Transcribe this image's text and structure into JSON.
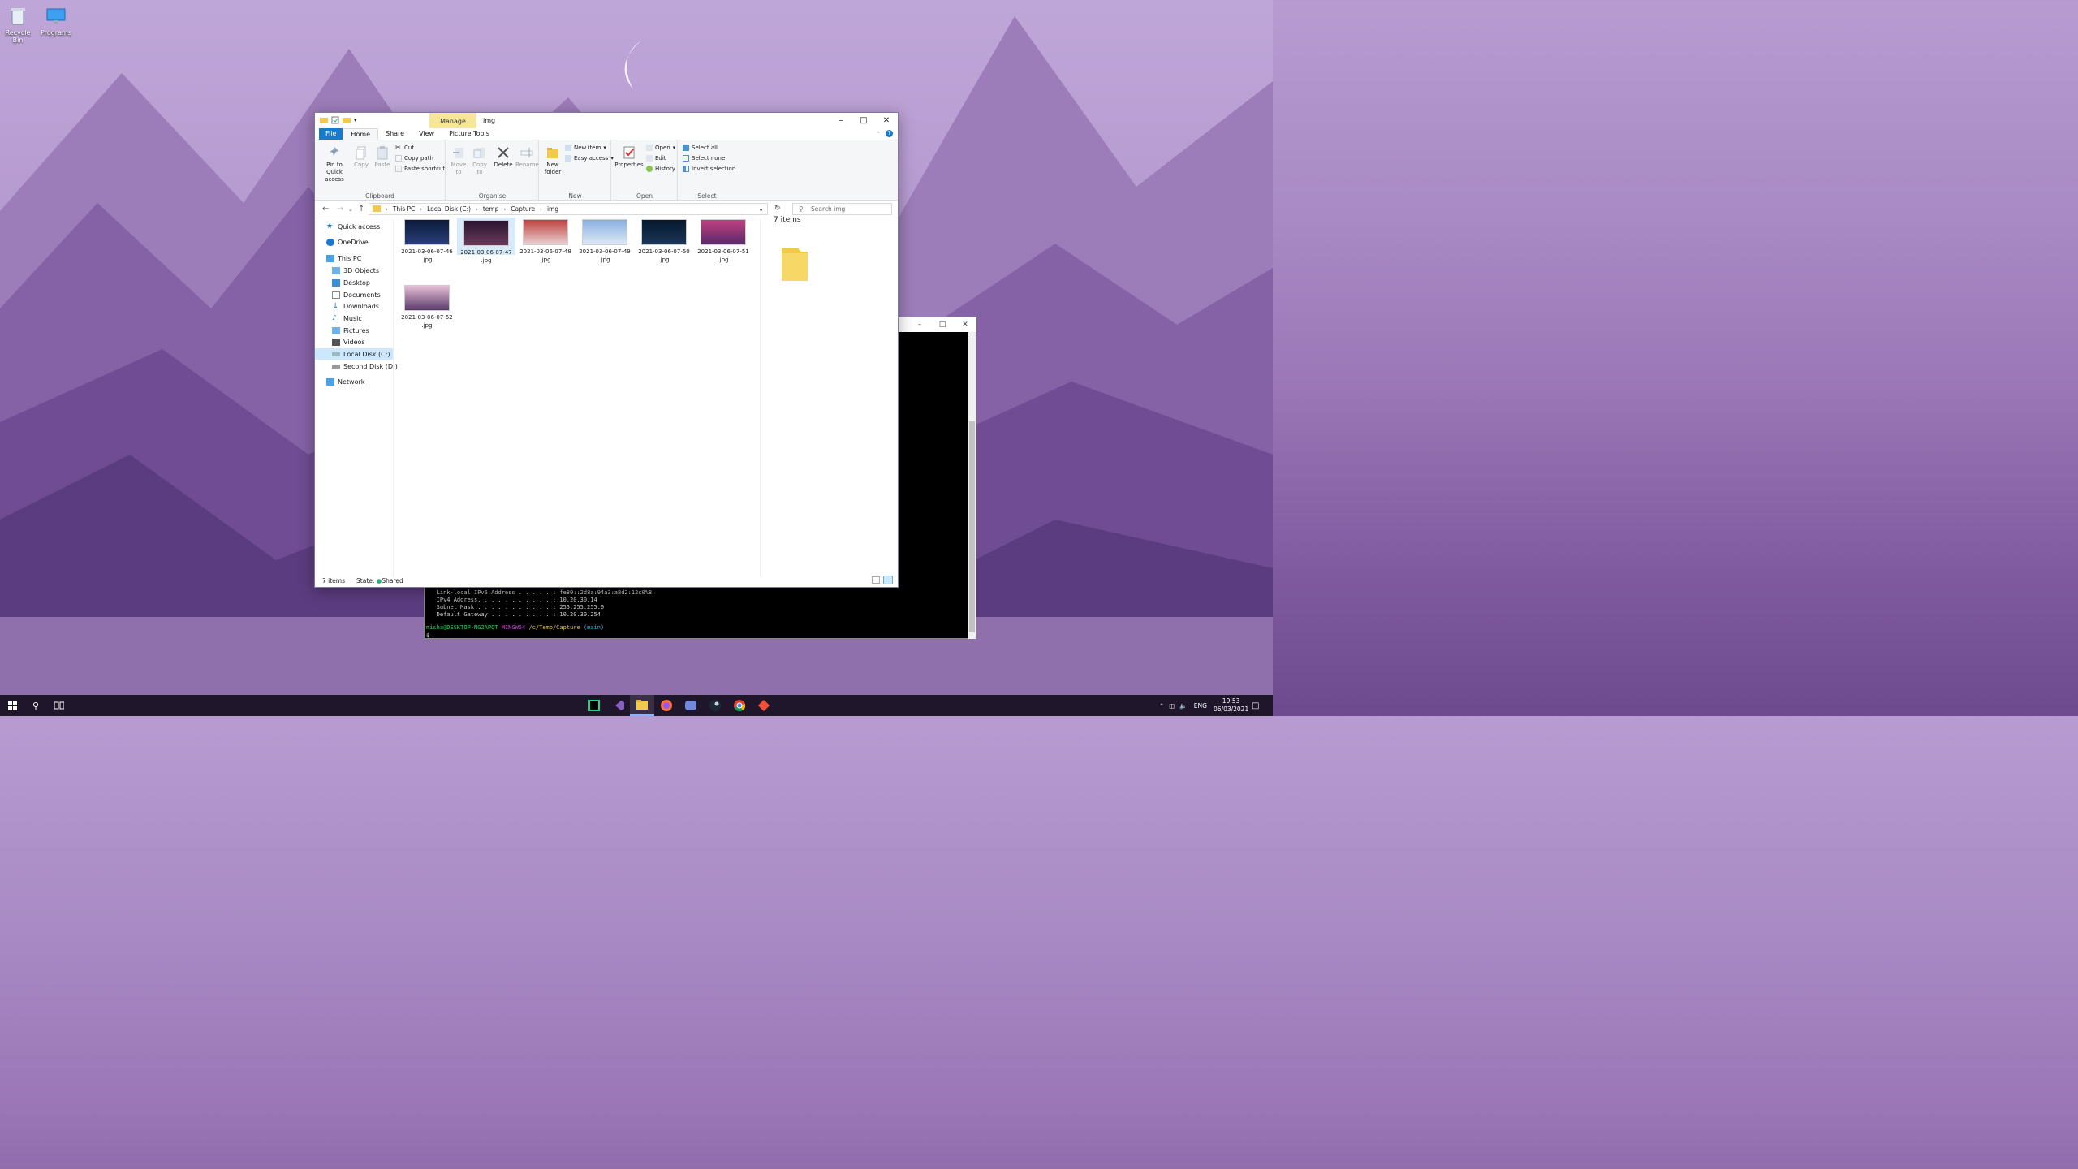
{
  "desktop": {
    "icons": [
      {
        "label": "Recycle Bin",
        "icon": "recycle-bin-icon"
      },
      {
        "label": "Programs",
        "icon": "monitor-icon"
      }
    ]
  },
  "explorer": {
    "title": "img",
    "context_tab": "Manage",
    "tabs": [
      "File",
      "Home",
      "Share",
      "View",
      "Picture Tools"
    ],
    "ribbon": {
      "clipboard": {
        "pin": "Pin to Quick access",
        "copy": "Copy",
        "paste": "Paste",
        "cut": "Cut",
        "copy_path": "Copy path",
        "paste_shortcut": "Paste shortcut",
        "label": "Clipboard"
      },
      "organise": {
        "move_to": "Move to",
        "copy_to": "Copy to",
        "delete": "Delete",
        "rename": "Rename",
        "label": "Organise"
      },
      "new": {
        "new_folder": "New folder",
        "new_item": "New item",
        "easy_access": "Easy access",
        "label": "New"
      },
      "open": {
        "properties": "Properties",
        "open": "Open",
        "edit": "Edit",
        "history": "History",
        "label": "Open"
      },
      "select": {
        "select_all": "Select all",
        "select_none": "Select none",
        "invert": "Invert selection",
        "label": "Select"
      }
    },
    "breadcrumb": [
      "This PC",
      "Local Disk (C:)",
      "temp",
      "Capture",
      "img"
    ],
    "search_placeholder": "Search img",
    "nav": {
      "quick_access": "Quick access",
      "onedrive": "OneDrive",
      "this_pc": "This PC",
      "items": [
        "3D Objects",
        "Desktop",
        "Documents",
        "Downloads",
        "Music",
        "Pictures",
        "Videos",
        "Local Disk (C:)",
        "Second Disk (D:)"
      ],
      "network": "Network"
    },
    "files": [
      {
        "name": "2021-03-06-07-46",
        "ext": ".jpg"
      },
      {
        "name": "2021-03-06-07-47",
        "ext": ".jpg"
      },
      {
        "name": "2021-03-06-07-48",
        "ext": ".jpg"
      },
      {
        "name": "2021-03-06-07-49",
        "ext": ".jpg"
      },
      {
        "name": "2021-03-06-07-50",
        "ext": ".jpg"
      },
      {
        "name": "2021-03-06-07-51",
        "ext": ".jpg"
      },
      {
        "name": "2021-03-06-07-52",
        "ext": ".jpg"
      }
    ],
    "details_count": "7 items",
    "status": {
      "count": "7 items",
      "state_label": "State:",
      "state_value": "Shared"
    }
  },
  "terminal": {
    "lines": [
      "   Link-local IPv6 Address . . . . . : fe80::2d8a:94a3:a8d2:12c0%8",
      "   IPv4 Address. . . . . . . . . . . : 10.20.30.14",
      "   Subnet Mask . . . . . . . . . . . : 255.255.255.0",
      "   Default Gateway . . . . . . . . . : 10.20.30.254"
    ],
    "prompt_user": "misha@DESKTOP-NG2APQT",
    "prompt_shell": "MINGW64",
    "prompt_path": "/c/Temp/Capture",
    "prompt_branch": "(main)",
    "prompt_symbol": "$"
  },
  "taskbar": {
    "apps": [
      "pycharm-icon",
      "visual-studio-icon",
      "file-explorer-icon",
      "firefox-icon",
      "discord-icon",
      "steam-icon",
      "chrome-icon",
      "git-icon"
    ],
    "language": "ENG",
    "time": "19:53",
    "date": "06/03/2021"
  }
}
